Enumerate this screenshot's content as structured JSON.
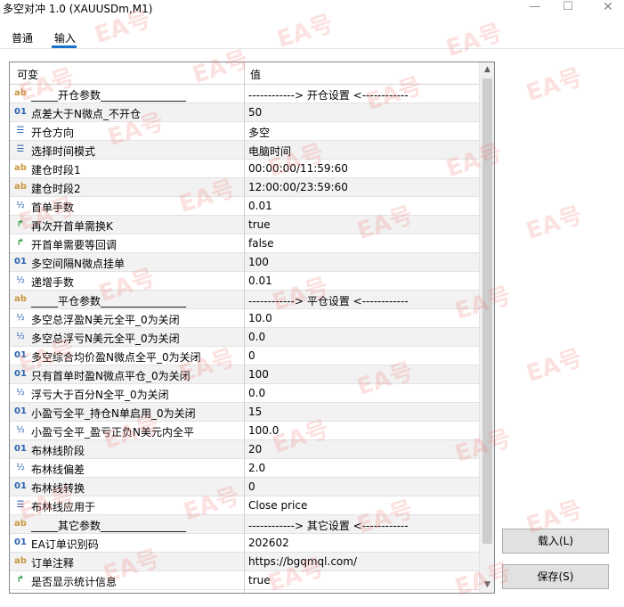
{
  "window": {
    "title": "多空对冲 1.0 (XAUUSDm,M1)",
    "min_glyph": "—",
    "max_glyph": "☐",
    "close_glyph": "✕"
  },
  "tabs": [
    {
      "label": "普通",
      "active": false
    },
    {
      "label": "输入",
      "active": true
    }
  ],
  "grid": {
    "headers": {
      "variable": "可变",
      "value": "值"
    },
    "rows": [
      {
        "icon": "ab",
        "name": "_____开仓参数________________",
        "value": "------------> 开仓设置 <------------"
      },
      {
        "icon": "01",
        "name": "点差大于N微点_不开仓",
        "value": "50"
      },
      {
        "icon": "list",
        "name": "开仓方向",
        "value": "多空"
      },
      {
        "icon": "list",
        "name": "选择时间模式",
        "value": "电脑时间"
      },
      {
        "icon": "ab",
        "name": "建仓时段1",
        "value": "00:00:00/11:59:60"
      },
      {
        "icon": "ab",
        "name": "建仓时段2",
        "value": "12:00:00/23:59:60"
      },
      {
        "icon": "half",
        "name": "首单手数",
        "value": "0.01"
      },
      {
        "icon": "bool",
        "name": "再次开首单需换K",
        "value": "true"
      },
      {
        "icon": "bool",
        "name": "开首单需要等回调",
        "value": "false"
      },
      {
        "icon": "01",
        "name": "多空间隔N微点挂单",
        "value": "100"
      },
      {
        "icon": "half",
        "name": "递增手数",
        "value": "0.01"
      },
      {
        "icon": "ab",
        "name": "_____平仓参数________________",
        "value": "------------> 平仓设置 <------------"
      },
      {
        "icon": "half",
        "name": "多空总浮盈N美元全平_0为关闭",
        "value": "10.0"
      },
      {
        "icon": "half",
        "name": "多空总浮亏N美元全平_0为关闭",
        "value": "0.0"
      },
      {
        "icon": "01",
        "name": "多空综合均价盈N微点全平_0为关闭",
        "value": "0"
      },
      {
        "icon": "01",
        "name": "只有首单时盈N微点平仓_0为关闭",
        "value": "100"
      },
      {
        "icon": "half",
        "name": "浮亏大于百分N全平_0为关闭",
        "value": "0.0"
      },
      {
        "icon": "01",
        "name": "小盈亏全平_持仓N单启用_0为关闭",
        "value": "15"
      },
      {
        "icon": "half",
        "name": "小盈亏全平_盈亏正负N美元内全平",
        "value": "100.0"
      },
      {
        "icon": "01",
        "name": "布林线阶段",
        "value": "20"
      },
      {
        "icon": "half",
        "name": "布林线偏差",
        "value": "2.0"
      },
      {
        "icon": "01",
        "name": "布林线转换",
        "value": "0"
      },
      {
        "icon": "list",
        "name": "布林线应用于",
        "value": "Close price"
      },
      {
        "icon": "ab",
        "name": "_____其它参数________________",
        "value": "------------> 其它设置 <------------"
      },
      {
        "icon": "01",
        "name": "EA订单识别码",
        "value": "202602"
      },
      {
        "icon": "ab",
        "name": "订单注释",
        "value": "https://bgqmql.com/"
      },
      {
        "icon": "bool",
        "name": "是否显示统计信息",
        "value": "true"
      }
    ]
  },
  "icon_glyphs": {
    "ab": "ab",
    "01": "01",
    "half": "½",
    "list": "☰",
    "bool": "↱"
  },
  "buttons": {
    "load": "载入(L)",
    "save": "保存(S)"
  },
  "watermark": "EA号"
}
